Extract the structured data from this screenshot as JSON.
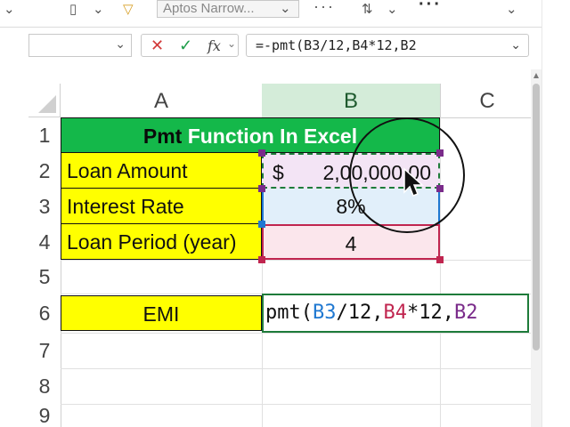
{
  "ribbon": {
    "font_name": "Aptos Narrow..."
  },
  "formula_bar": {
    "fx_label": "fx",
    "formula": "=-pmt(B3/12,B4*12,B2"
  },
  "columns": [
    "A",
    "B",
    "C"
  ],
  "rows": [
    "1",
    "2",
    "3",
    "4",
    "5",
    "6",
    "7",
    "8",
    "9"
  ],
  "cells": {
    "title_part1": "Pmt",
    "title_part2": " Function In Excel",
    "a2": "Loan Amount",
    "a3": "Interest Rate",
    "a4": "Loan Period (year)",
    "b2_currency": "$",
    "b2_value": "2,00,000.00",
    "b3": "8%",
    "b4": "4",
    "a6": "EMI",
    "b6_parts": [
      "pmt(",
      "B3",
      "/12,",
      "B4",
      "*12,",
      "B2"
    ]
  },
  "colors": {
    "title_bg": "#14b84a",
    "label_bg": "#ffff00",
    "b2_bg": "#f3e4f5",
    "b3_bg": "#e1effa",
    "b4_bg": "#fbe6ec",
    "ref_b3": "#1f78d1",
    "ref_b4": "#c0254f",
    "ref_b2": "#7a2b8a",
    "active_border": "#1e7b3a"
  }
}
